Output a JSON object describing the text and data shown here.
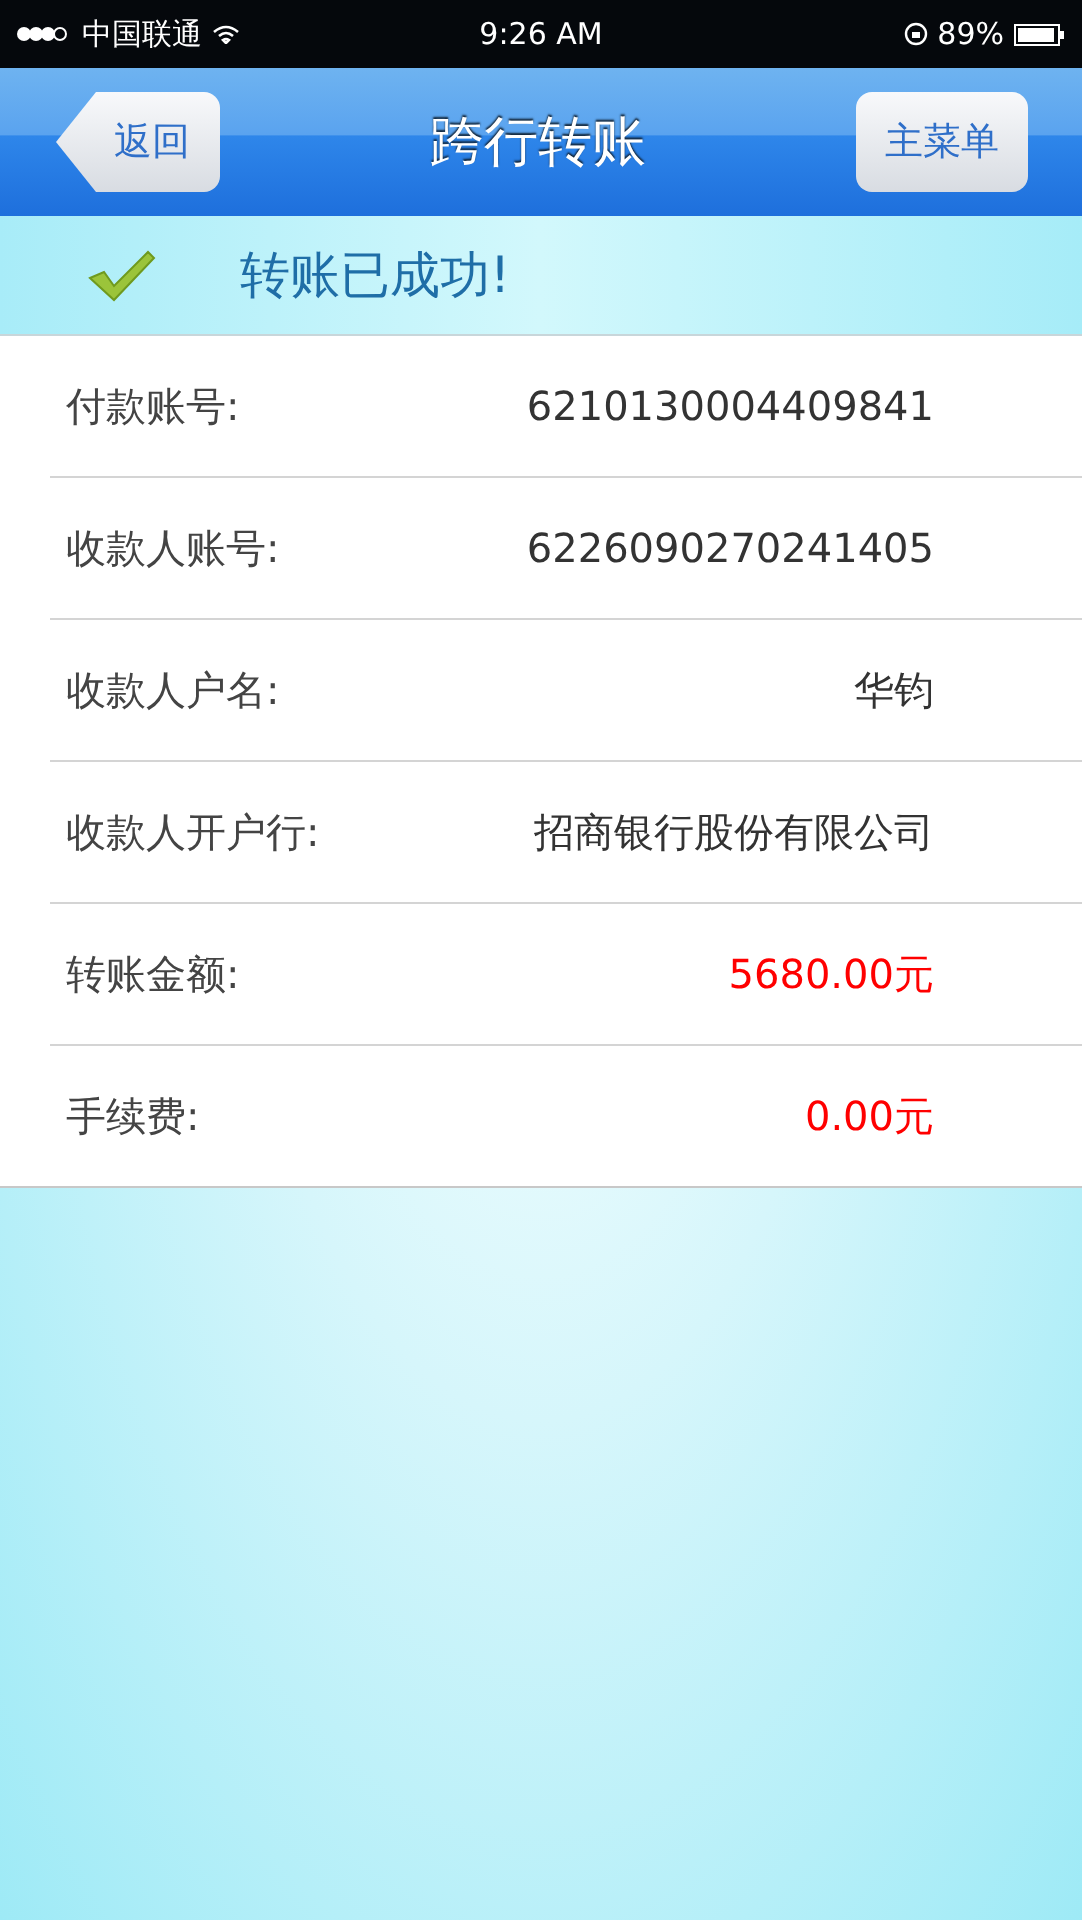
{
  "status_bar": {
    "carrier": "中国联通",
    "time": "9:26 AM",
    "battery": "89%"
  },
  "nav": {
    "back": "返回",
    "title": "跨行转账",
    "menu": "主菜单"
  },
  "result": {
    "message": "转账已成功!"
  },
  "rows": [
    {
      "label": "付款账号:",
      "value": "6210130004409841",
      "kind": "plain"
    },
    {
      "label": "收款人账号:",
      "value": "6226090270241405",
      "kind": "plain"
    },
    {
      "label": "收款人户名:",
      "value": "华钧",
      "kind": "plain"
    },
    {
      "label": "收款人开户行:",
      "value": "招商银行股份有限公司",
      "kind": "plain"
    },
    {
      "label": "转账金额:",
      "value": "5680.00元",
      "kind": "amount"
    },
    {
      "label": "手续费:",
      "value": "0.00元",
      "kind": "amount"
    }
  ]
}
